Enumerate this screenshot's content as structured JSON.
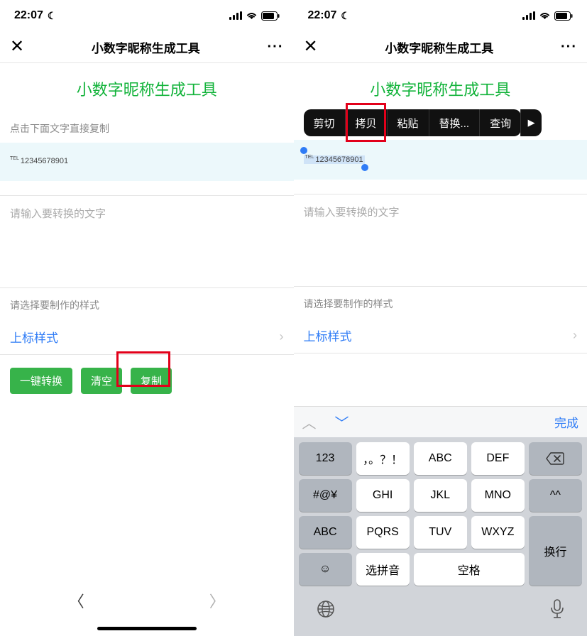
{
  "status": {
    "time": "22:07"
  },
  "nav": {
    "title": "小数字昵称生成工具"
  },
  "app": {
    "title": "小数字昵称生成工具"
  },
  "labels": {
    "tap_to_copy": "点击下面文字直接复制",
    "input_placeholder": "请输入要转换的文字",
    "style_label": "请选择要制作的样式"
  },
  "output": {
    "prefix": "TEL",
    "digits": "12345678901"
  },
  "style": {
    "value": "上标样式"
  },
  "buttons": {
    "convert": "一键转换",
    "clear": "清空",
    "copy": "复制"
  },
  "context_menu": {
    "cut": "剪切",
    "copy": "拷贝",
    "paste": "粘贴",
    "replace": "替换...",
    "lookup": "查询"
  },
  "keyboard": {
    "done": "完成",
    "keys": {
      "k123": "123",
      "punct": "，。？！",
      "abc2": "ABC",
      "def": "DEF",
      "sym": "#@¥",
      "ghi": "GHI",
      "jkl": "JKL",
      "mno": "MNO",
      "caret": "^^",
      "abc4": "ABC",
      "pqrs": "PQRS",
      "tuv": "TUV",
      "wxyz": "WXYZ",
      "enter": "换行",
      "pinyin": "选拼音",
      "space": "空格"
    }
  }
}
